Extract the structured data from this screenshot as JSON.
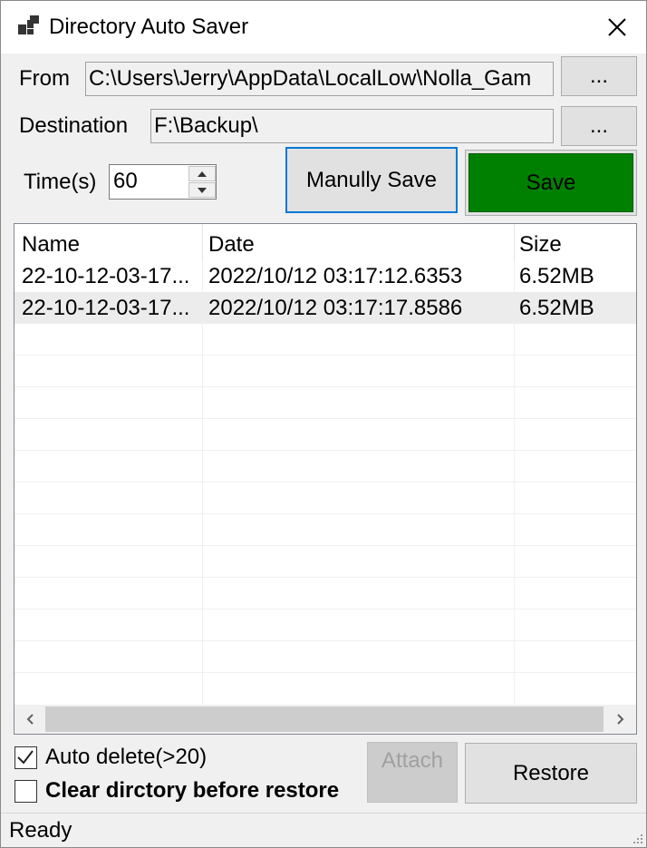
{
  "window": {
    "title": "Directory Auto Saver"
  },
  "from": {
    "label": "From",
    "value": "C:\\Users\\Jerry\\AppData\\LocalLow\\Nolla_Gam",
    "browse_label": "..."
  },
  "destination": {
    "label": "Destination",
    "value": "F:\\Backup\\",
    "browse_label": "..."
  },
  "time": {
    "label": "Time(s)",
    "value": "60"
  },
  "buttons": {
    "manual_save": "Manully Save",
    "save": "Save",
    "attach": "Attach",
    "restore": "Restore"
  },
  "list": {
    "columns": [
      "Name",
      "Date",
      "Size"
    ],
    "rows": [
      {
        "name": "22-10-12-03-17...",
        "date": "2022/10/12 03:17:12.6353",
        "size": "6.52MB"
      },
      {
        "name": "22-10-12-03-17...",
        "date": "2022/10/12 03:17:17.8586",
        "size": "6.52MB"
      }
    ]
  },
  "options": {
    "auto_delete": "Auto delete(>20)",
    "auto_delete_checked": true,
    "clear_before_restore": "Clear dirctory before restore",
    "clear_checked": false
  },
  "status": {
    "text": "Ready"
  },
  "colors": {
    "save_green": "#008000",
    "focus_blue": "#0078d7"
  }
}
